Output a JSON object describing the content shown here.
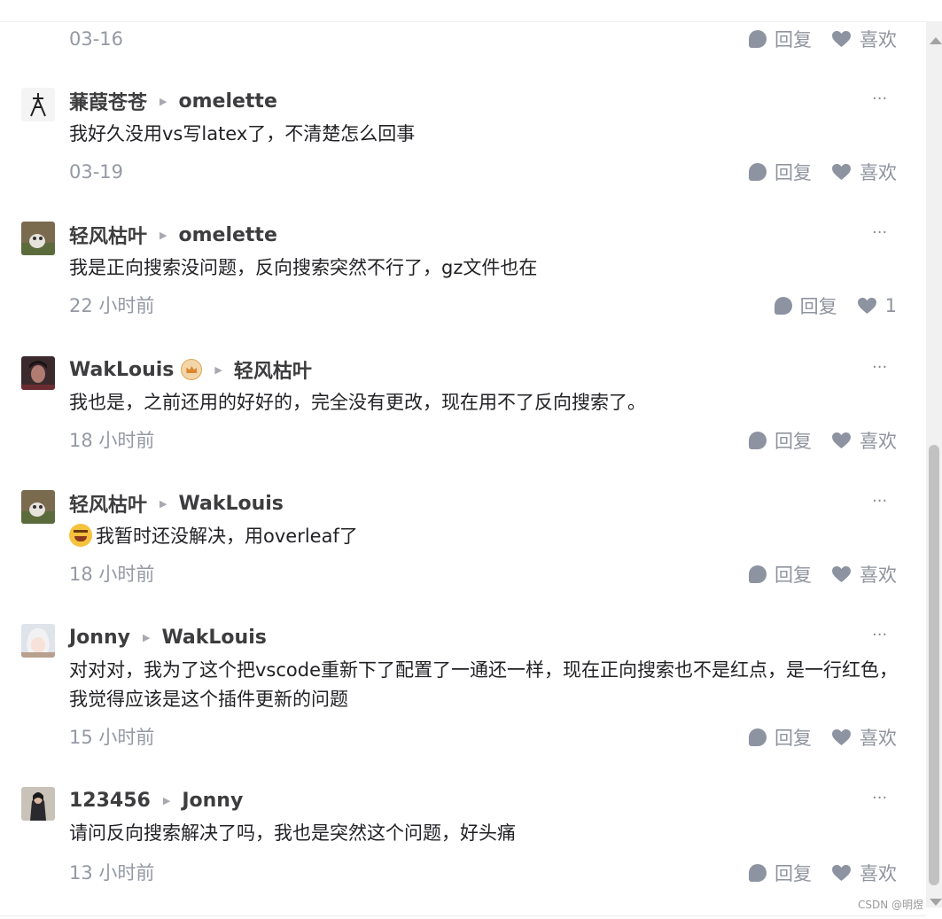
{
  "labels": {
    "reply": "回复",
    "like": "喜欢",
    "more": "···"
  },
  "first_meta": {
    "time": "03-16"
  },
  "comments": [
    {
      "author": "蒹葭苍苍",
      "reply_to": "omelette",
      "text": "我好久没用vs写latex了，不清楚怎么回事",
      "time": "03-19",
      "like": "喜欢"
    },
    {
      "author": "轻风枯叶",
      "reply_to": "omelette",
      "text": "我是正向搜索没问题，反向搜索突然不行了，gz文件也在",
      "time": "22 小时前",
      "like": "1"
    },
    {
      "author": "WakLouis",
      "reply_to": "轻风枯叶",
      "text": "我也是，之前还用的好好的，完全没有更改，现在用不了反向搜索了。",
      "time": "18 小时前",
      "like": "喜欢"
    },
    {
      "author": "轻风枯叶",
      "reply_to": "WakLouis",
      "text": "我暂时还没解决，用overleaf了",
      "time": "18 小时前",
      "like": "喜欢"
    },
    {
      "author": "Jonny",
      "reply_to": "WakLouis",
      "text": "对对对，我为了这个把vscode重新下了配置了一通还一样，现在正向搜索也不是红点，是一行红色，我觉得应该是这个插件更新的问题",
      "time": "15 小时前",
      "like": "喜欢"
    },
    {
      "author": "123456",
      "reply_to": "Jonny",
      "text": "请问反向搜索解决了吗，我也是突然这个问题，好头痛",
      "time": "13 小时前",
      "like": "喜欢"
    }
  ],
  "watermark": "CSDN @明煜",
  "colors": {
    "meta": "#9499a4",
    "action_icon": "#8d93a0",
    "author": "#3d3d3f",
    "badge": "#e0a456"
  }
}
